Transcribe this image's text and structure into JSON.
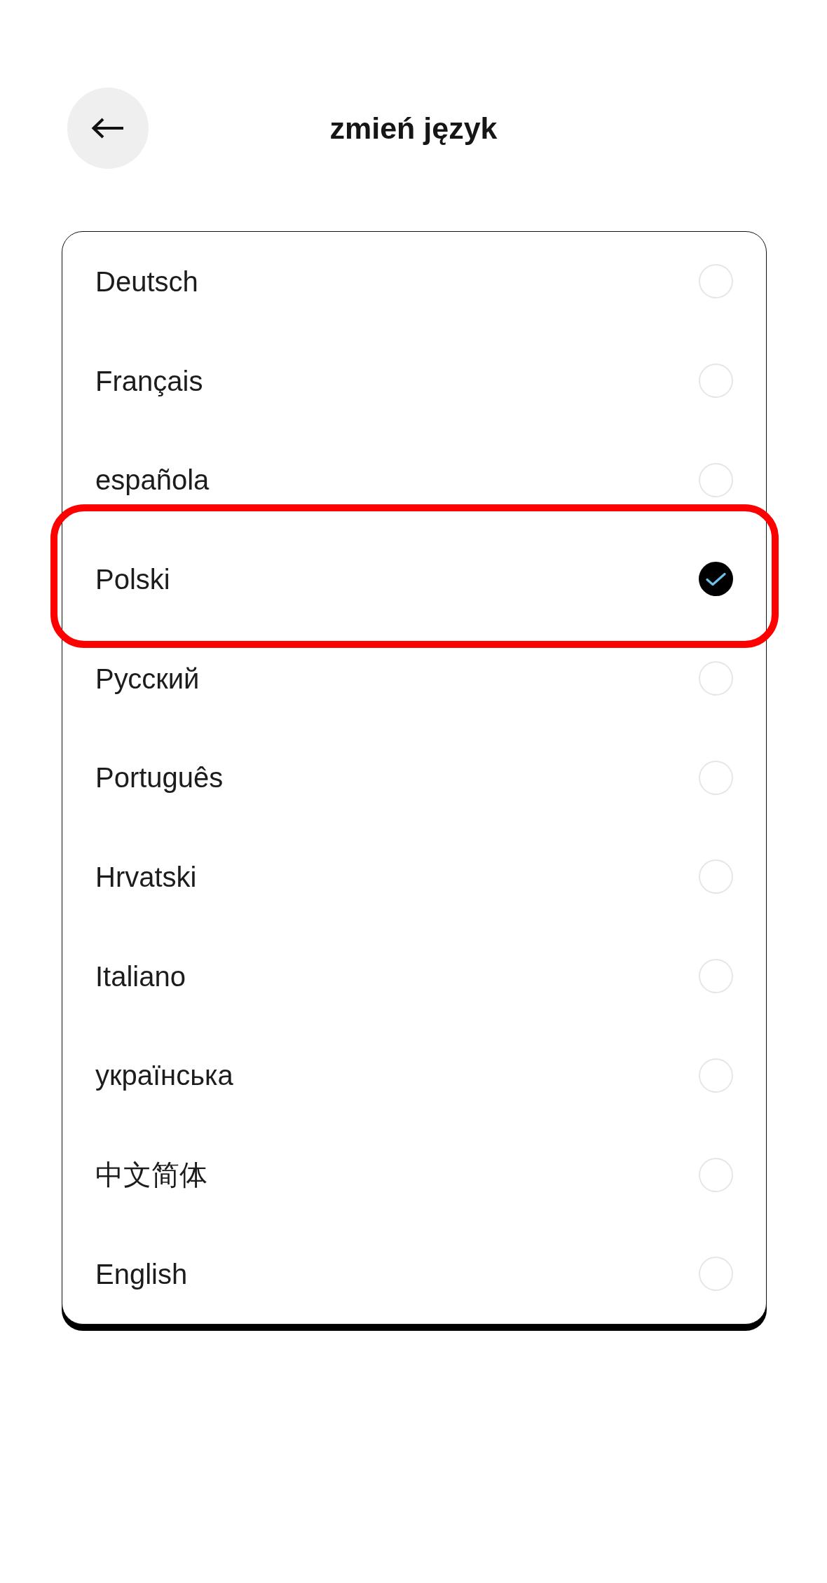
{
  "header": {
    "title": "zmień język"
  },
  "languages": [
    {
      "name": "Deutsch",
      "selected": false,
      "highlighted": false
    },
    {
      "name": "Français",
      "selected": false,
      "highlighted": false
    },
    {
      "name": "española",
      "selected": false,
      "highlighted": false
    },
    {
      "name": "Polski",
      "selected": true,
      "highlighted": true
    },
    {
      "name": "Русский",
      "selected": false,
      "highlighted": false
    },
    {
      "name": "Português",
      "selected": false,
      "highlighted": false
    },
    {
      "name": "Hrvatski",
      "selected": false,
      "highlighted": false
    },
    {
      "name": "Italiano",
      "selected": false,
      "highlighted": false
    },
    {
      "name": "українська",
      "selected": false,
      "highlighted": false
    },
    {
      "name": "中文简体",
      "selected": false,
      "highlighted": false
    },
    {
      "name": "English",
      "selected": false,
      "highlighted": false
    }
  ]
}
